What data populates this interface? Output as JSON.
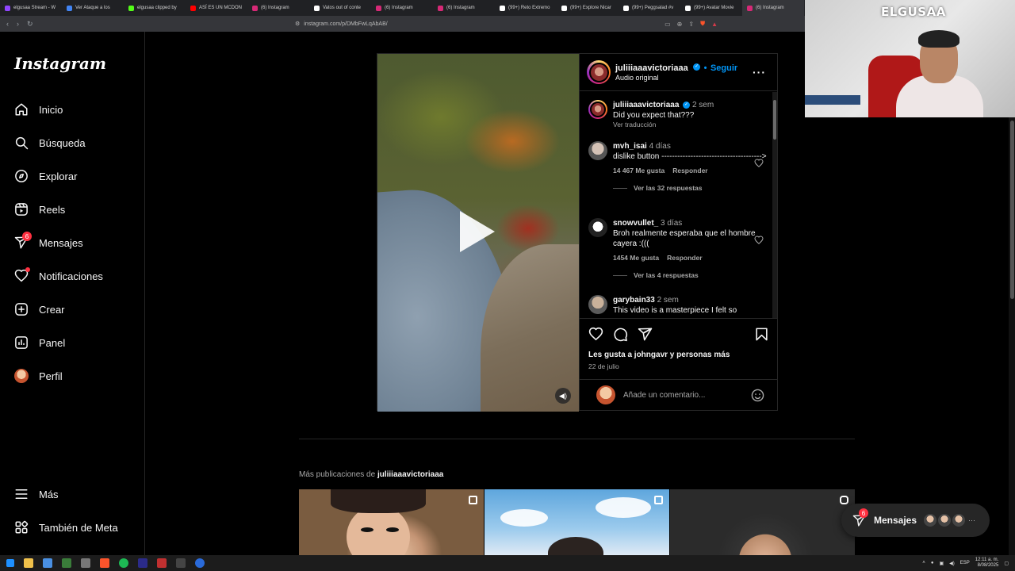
{
  "browser": {
    "tabs": [
      {
        "label": "elgusaa Stream - W",
        "color": "#9146ff"
      },
      {
        "label": "Ver Ataque a los",
        "color": "#4285f4"
      },
      {
        "label": "elgusaa clipped by",
        "color": "#53fc18"
      },
      {
        "label": "ASÍ ES UN MCDON",
        "color": "#ff0000"
      },
      {
        "label": "(6) Instagram",
        "color": "#d62976"
      },
      {
        "label": "Vatos out of conte",
        "color": "#ffffff"
      },
      {
        "label": "(6) Instagram",
        "color": "#d62976"
      },
      {
        "label": "(6) Instagram",
        "color": "#d62976"
      },
      {
        "label": "(99+) Reto Extremo",
        "color": "#ffffff"
      },
      {
        "label": "(99+) Explore Nicar",
        "color": "#ffffff"
      },
      {
        "label": "(99+) Peggsalad #v",
        "color": "#ffffff"
      },
      {
        "label": "(99+) Avatar Movie",
        "color": "#ffffff"
      },
      {
        "label": "(6) Instagram",
        "color": "#d62976"
      }
    ],
    "url": "instagram.com/p/DMbFwLqAbAB/"
  },
  "webcam": {
    "brand": "ELGUSAA"
  },
  "sidebar": {
    "logo": "Instagram",
    "items": [
      {
        "label": "Inicio",
        "icon": "home-icon"
      },
      {
        "label": "Búsqueda",
        "icon": "search-icon"
      },
      {
        "label": "Explorar",
        "icon": "compass-icon"
      },
      {
        "label": "Reels",
        "icon": "reels-icon"
      },
      {
        "label": "Mensajes",
        "icon": "direct-icon",
        "badge": "6"
      },
      {
        "label": "Notificaciones",
        "icon": "heart-icon"
      },
      {
        "label": "Crear",
        "icon": "plus-icon"
      },
      {
        "label": "Panel",
        "icon": "dashboard-icon"
      },
      {
        "label": "Perfil",
        "icon": "avatar"
      }
    ],
    "bottom": [
      {
        "label": "Más",
        "icon": "menu-icon"
      },
      {
        "label": "También de Meta",
        "icon": "meta-icon"
      }
    ]
  },
  "post": {
    "username": "juliiiaaavictoriaaa",
    "follow": "Seguir",
    "dot": "•",
    "audio": "Audio original",
    "caption": {
      "user": "juliiiaaavictoriaaa",
      "time": "2 sem",
      "text": "Did you expect that???",
      "translate": "Ver traducción"
    },
    "comments": [
      {
        "user": "mvh_isai",
        "time": "4 días",
        "text": "dislike button -------------------------------------->",
        "likes": "14 467 Me gusta",
        "reply": "Responder",
        "replies": "Ver las 32 respuestas"
      },
      {
        "user": "snowvullet_",
        "time": "3 días",
        "text": "Broh realmente esperaba que el hombre cayera :(((",
        "likes": "1454 Me gusta",
        "reply": "Responder",
        "replies": "Ver las 4 respuestas"
      },
      {
        "user": "garybain33",
        "time": "2 sem",
        "text": "This video is a masterpiece I felt so"
      }
    ],
    "liked_by": "Les gusta a johngavr y personas más",
    "date": "22 de julio",
    "add_comment_placeholder": "Añade un comentario..."
  },
  "more_posts": {
    "prefix": "Más publicaciones de",
    "user": "juliiiaaavictoriaaa"
  },
  "messages_bar": {
    "label": "Mensajes",
    "badge": "6",
    "more": "···"
  },
  "taskbar": {
    "lang": "ESP",
    "time": "12:11 a. m.",
    "date": "8/08/2025"
  },
  "colors": {
    "accent": "#0095f6",
    "notification": "#ff3040",
    "background": "#000000"
  }
}
